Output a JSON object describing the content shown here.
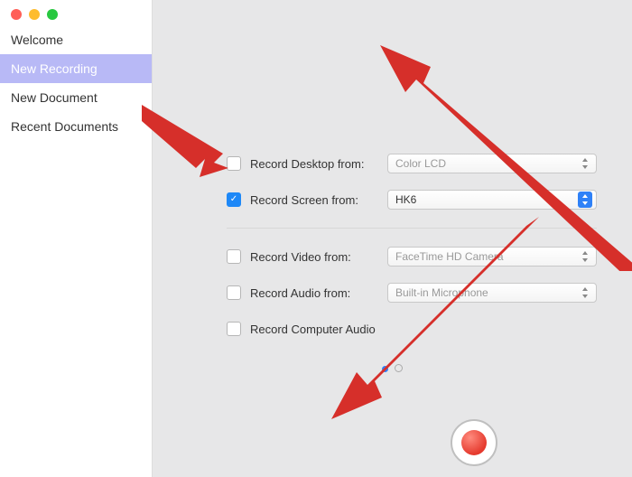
{
  "sidebar": {
    "items": [
      {
        "label": "Welcome"
      },
      {
        "label": "New Recording"
      },
      {
        "label": "New Document"
      },
      {
        "label": "Recent Documents"
      }
    ],
    "selected_index": 1
  },
  "form": {
    "desktop": {
      "label": "Record Desktop from:",
      "checked": false,
      "value": "Color LCD"
    },
    "screen": {
      "label": "Record Screen from:",
      "checked": true,
      "value": "HK6"
    },
    "video": {
      "label": "Record Video from:",
      "checked": false,
      "value": "FaceTime HD Camera"
    },
    "audio": {
      "label": "Record Audio from:",
      "checked": false,
      "value": "Built-in Microphone"
    },
    "computer_audio": {
      "label": "Record Computer Audio",
      "checked": false
    }
  }
}
